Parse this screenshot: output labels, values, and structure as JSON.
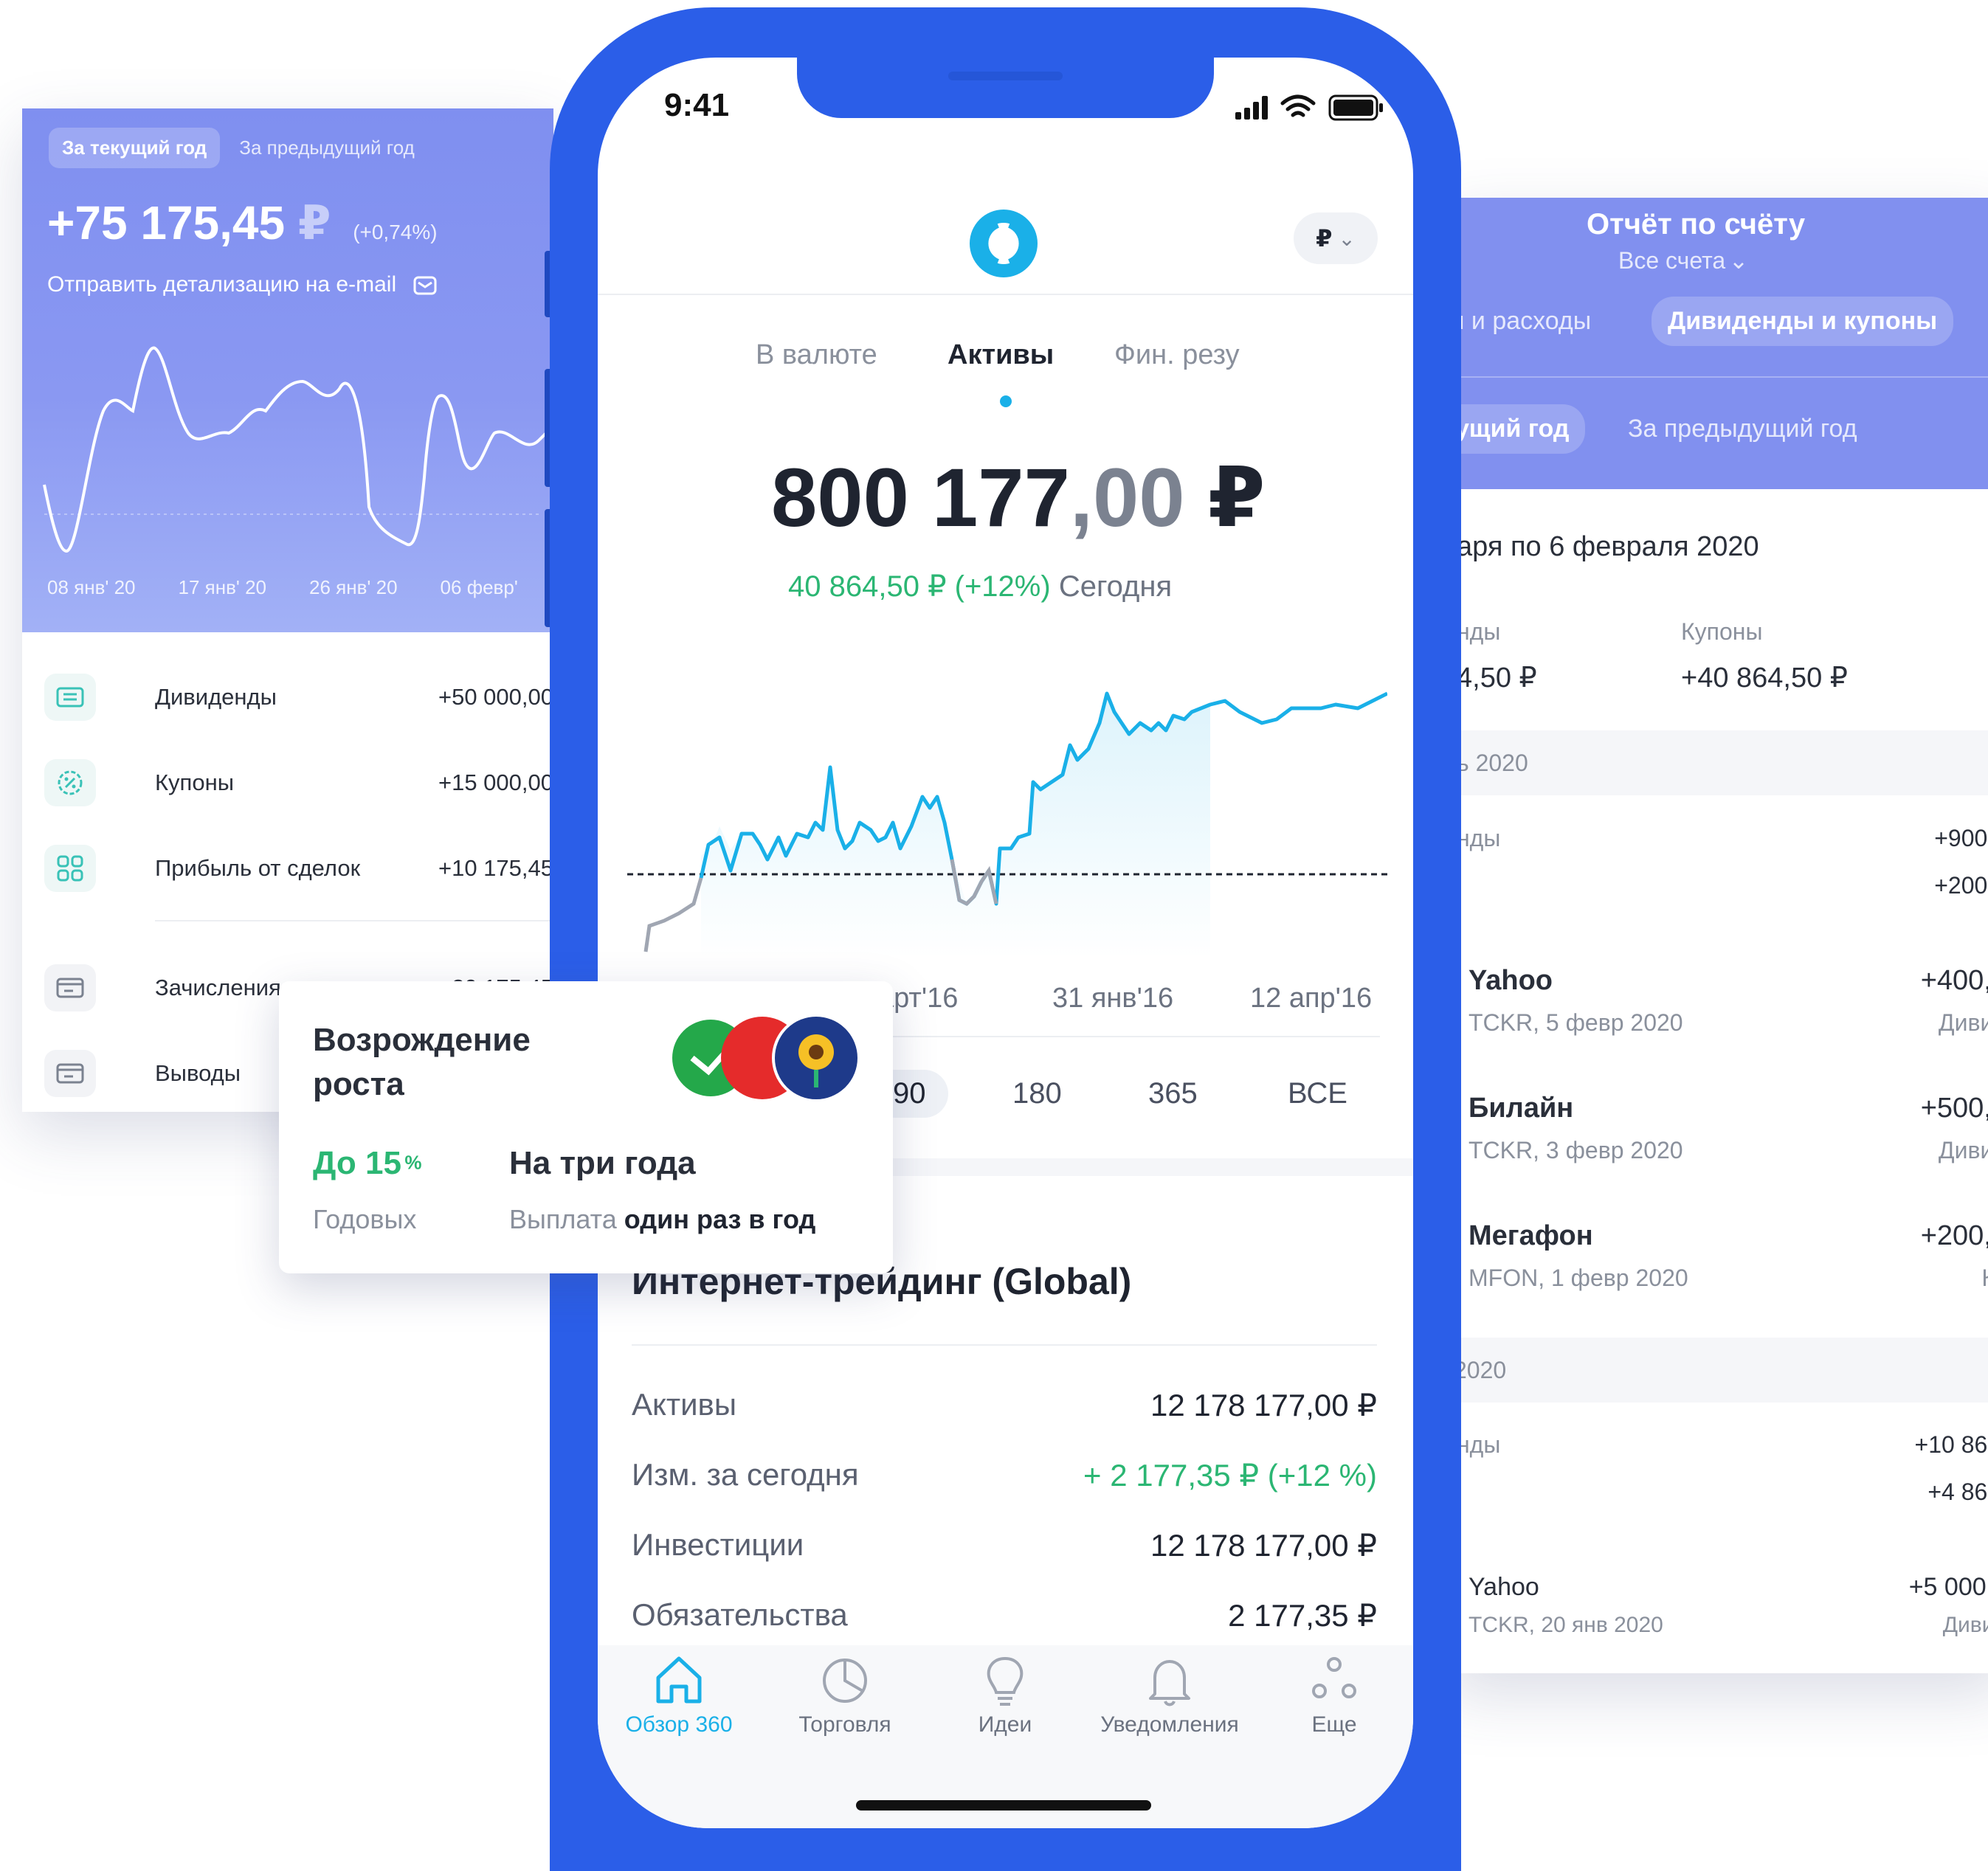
{
  "left_card": {
    "tab_current": "За текущий год",
    "tab_previous": "За предыдущий год",
    "amount": "+75 175,45",
    "currency": "₽",
    "percent": "(+0,74%)",
    "email_link": "Отправить детализацию на e-mail",
    "x_ticks": [
      "08 янв' 20",
      "17 янв' 20",
      "26 янв' 20",
      "06 февр'"
    ],
    "rows": [
      {
        "label": "Дивиденды",
        "value": "+50 000,00"
      },
      {
        "label": "Купоны",
        "value": "+15 000,00"
      },
      {
        "label": "Прибыль от сделок",
        "value": "+10 175,45"
      },
      {
        "label": "Зачисления",
        "value": "+20 175,45"
      },
      {
        "label": "Выводы",
        "value": ""
      }
    ]
  },
  "right_card": {
    "title": "Отчёт по счёту",
    "subtitle": "Все счета",
    "tab1": "ы и расходы",
    "tab2": "Дивиденды и купоны",
    "period_current": "ущий год",
    "period_previous": "За предыдущий год",
    "range": "аря по 6 февраля 2020",
    "sum_div_label": "нды",
    "sum_div_value": "4,50 ₽",
    "sum_coupon_label": "Купоны",
    "sum_coupon_value": "+40 864,50 ₽",
    "month1": "ь 2020",
    "month1_label": "нды",
    "month1_v1": "+900,0",
    "month1_v2": "+200,0",
    "items": [
      {
        "name": "Yahoo",
        "sub": "TCKR, 5 февр 2020",
        "value": "+400,0",
        "type": "Дивид"
      },
      {
        "name": "Билайн",
        "sub": "TCKR, 3 февр 2020",
        "value": "+500,0",
        "type": "Дивид"
      },
      {
        "name": "Мегафон",
        "sub": "MFON, 1 февр 2020",
        "value": "+200,0",
        "type": "Ку"
      }
    ],
    "month2": "2020",
    "month2_label": "нды",
    "month2_v1": "+10 864,",
    "month2_v2": "+4 864,",
    "item_last": {
      "name": "Yahoo",
      "sub": "TCKR, 20 янв 2020",
      "value": "+5 000,0",
      "type": "Дивид"
    }
  },
  "phone": {
    "time": "9:41",
    "currency_selector": "₽",
    "tabs": [
      "В валюте",
      "Активы",
      "Фин. резу"
    ],
    "active_tab": 1,
    "amount_int": "800 177",
    "amount_dec": ",00",
    "amount_cur": "₽",
    "today_change": "40 864,50 ₽ (+12%)",
    "today_label": "Сегодня",
    "x_labels": [
      "арт'16",
      "31 янв'16",
      "12 апр'16"
    ],
    "periods": [
      "90",
      "180",
      "365",
      "ВСЕ"
    ],
    "active_period": 0,
    "account_title": "Интернет-трейдинг (Global)",
    "account_rows": [
      {
        "label": "Активы",
        "value": "12 178 177,00 ₽"
      },
      {
        "label": "Изм. за сегодня",
        "value": "+ 2 177,35 ₽ (+12 %)"
      },
      {
        "label": "Инвестиции",
        "value": "12 178 177,00 ₽"
      },
      {
        "label": "Обязательства",
        "value": "2 177,35 ₽"
      }
    ],
    "nav": [
      "Обзор 360",
      "Торговля",
      "Идеи",
      "Уведомления",
      "Еще"
    ],
    "active_nav": 0
  },
  "promo": {
    "title": "Возрождение роста",
    "rate": "До 15",
    "rate_unit": "%",
    "rate_label": "Годовых",
    "term": "На три года",
    "payout_prefix": "Выплата",
    "payout_bold": "один раз в год"
  },
  "colors": {
    "phone_frame": "#2b5ee8",
    "accent_cyan": "#1ab0e8",
    "positive_green": "#2bb673",
    "card_header": "#8190ef"
  }
}
